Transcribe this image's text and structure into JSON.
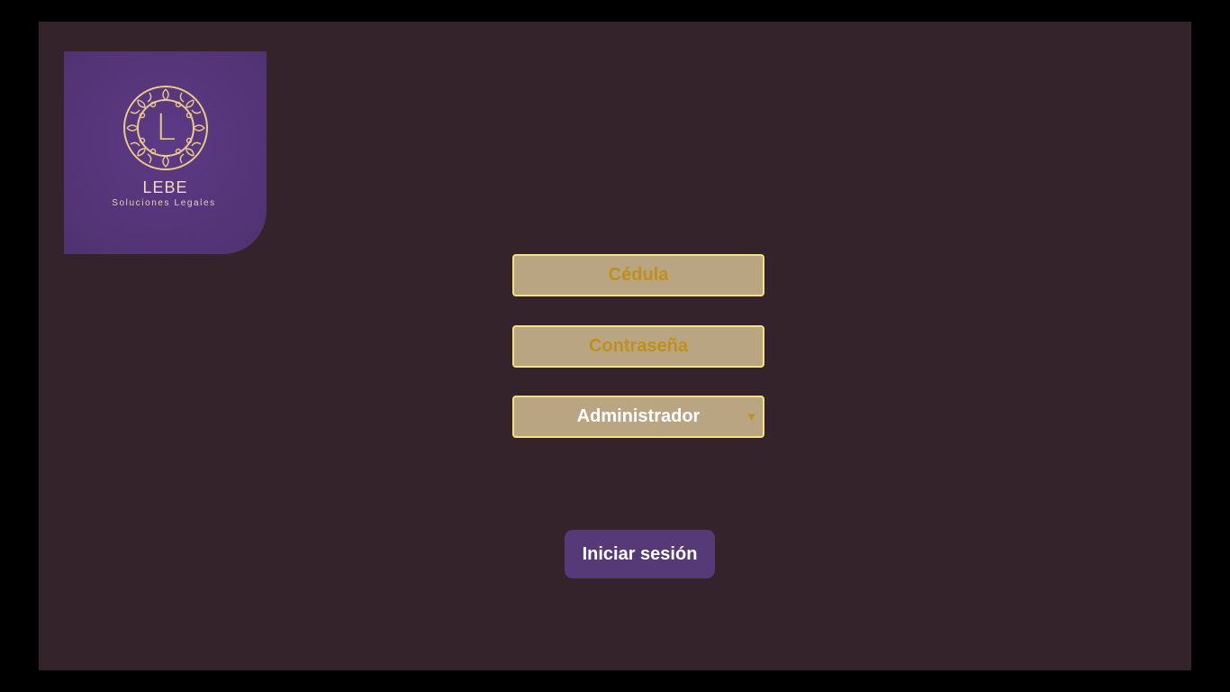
{
  "brand": {
    "logo_letter": "L",
    "name": "LEBE",
    "tagline": "Soluciones Legales"
  },
  "form": {
    "cedula_placeholder": "Cédula",
    "password_placeholder": "Contraseña",
    "role_selected": "Administrador",
    "submit_label": "Iniciar sesión"
  },
  "icons": {
    "emblem": "ornamental-circle-emblem",
    "dropdown": "chevron-down-icon"
  },
  "colors": {
    "page_bg": "#34232b",
    "brand_purple": "#553578",
    "field_bg": "#b9a581",
    "field_border": "#f3e27e",
    "accent_gold": "#c0901c",
    "button_bg": "#563a78"
  }
}
